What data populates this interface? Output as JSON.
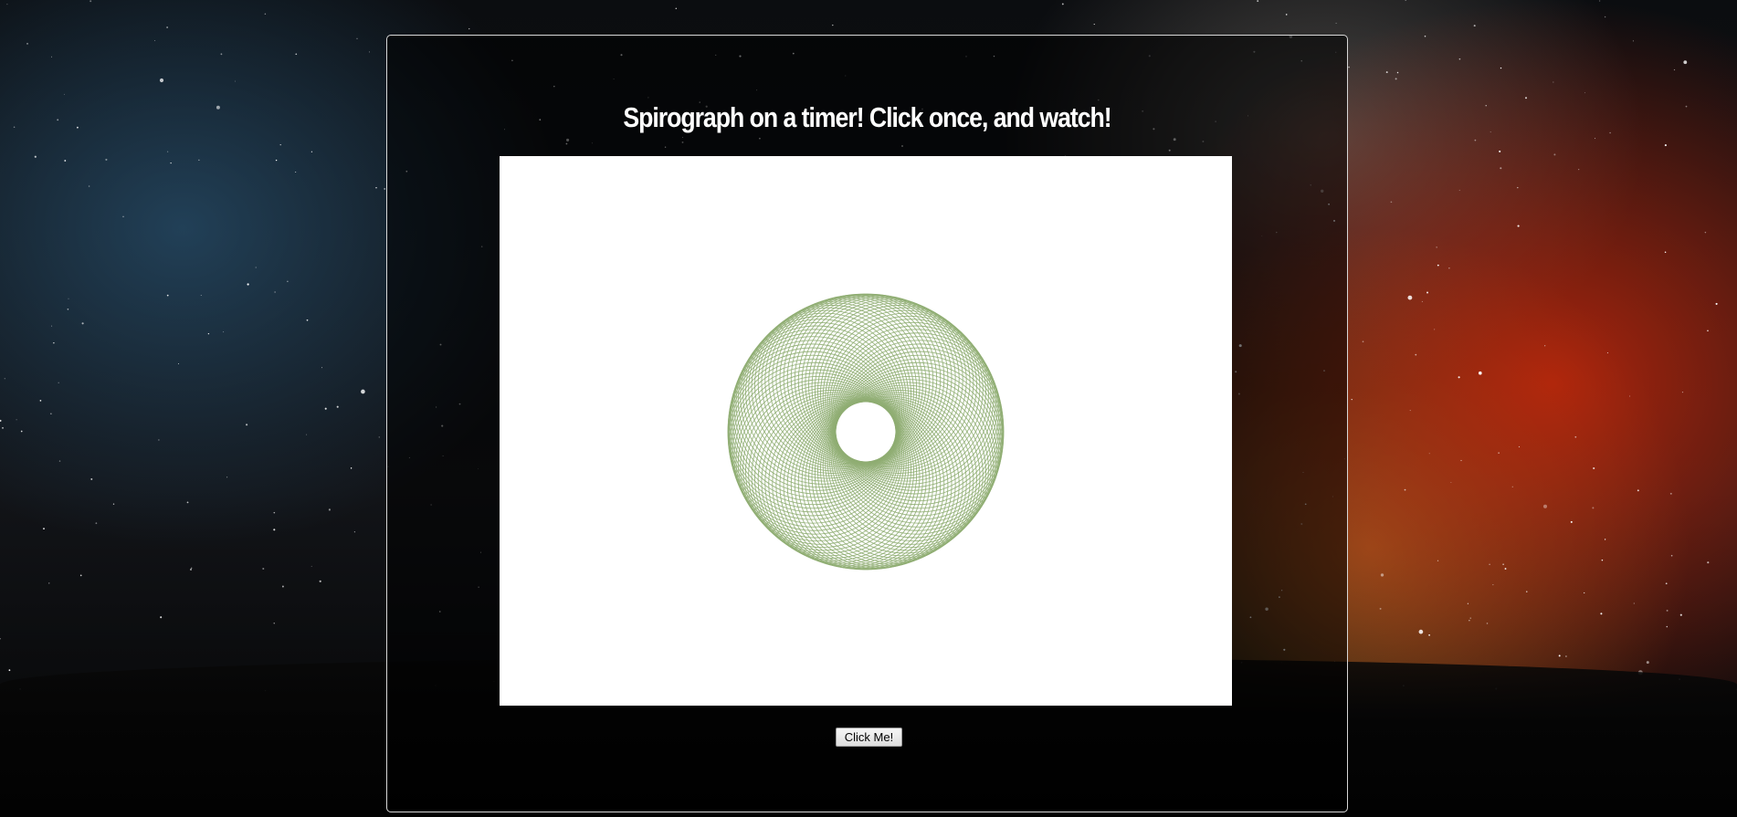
{
  "page": {
    "title": "Spirograph on a timer! Click once, and watch!",
    "button_label": "Click Me!"
  },
  "spirograph": {
    "color": "#8fad72",
    "background": "#ffffff"
  },
  "colors": {
    "panel_border": "#d8d8d8",
    "title_text": "#ffffff"
  }
}
